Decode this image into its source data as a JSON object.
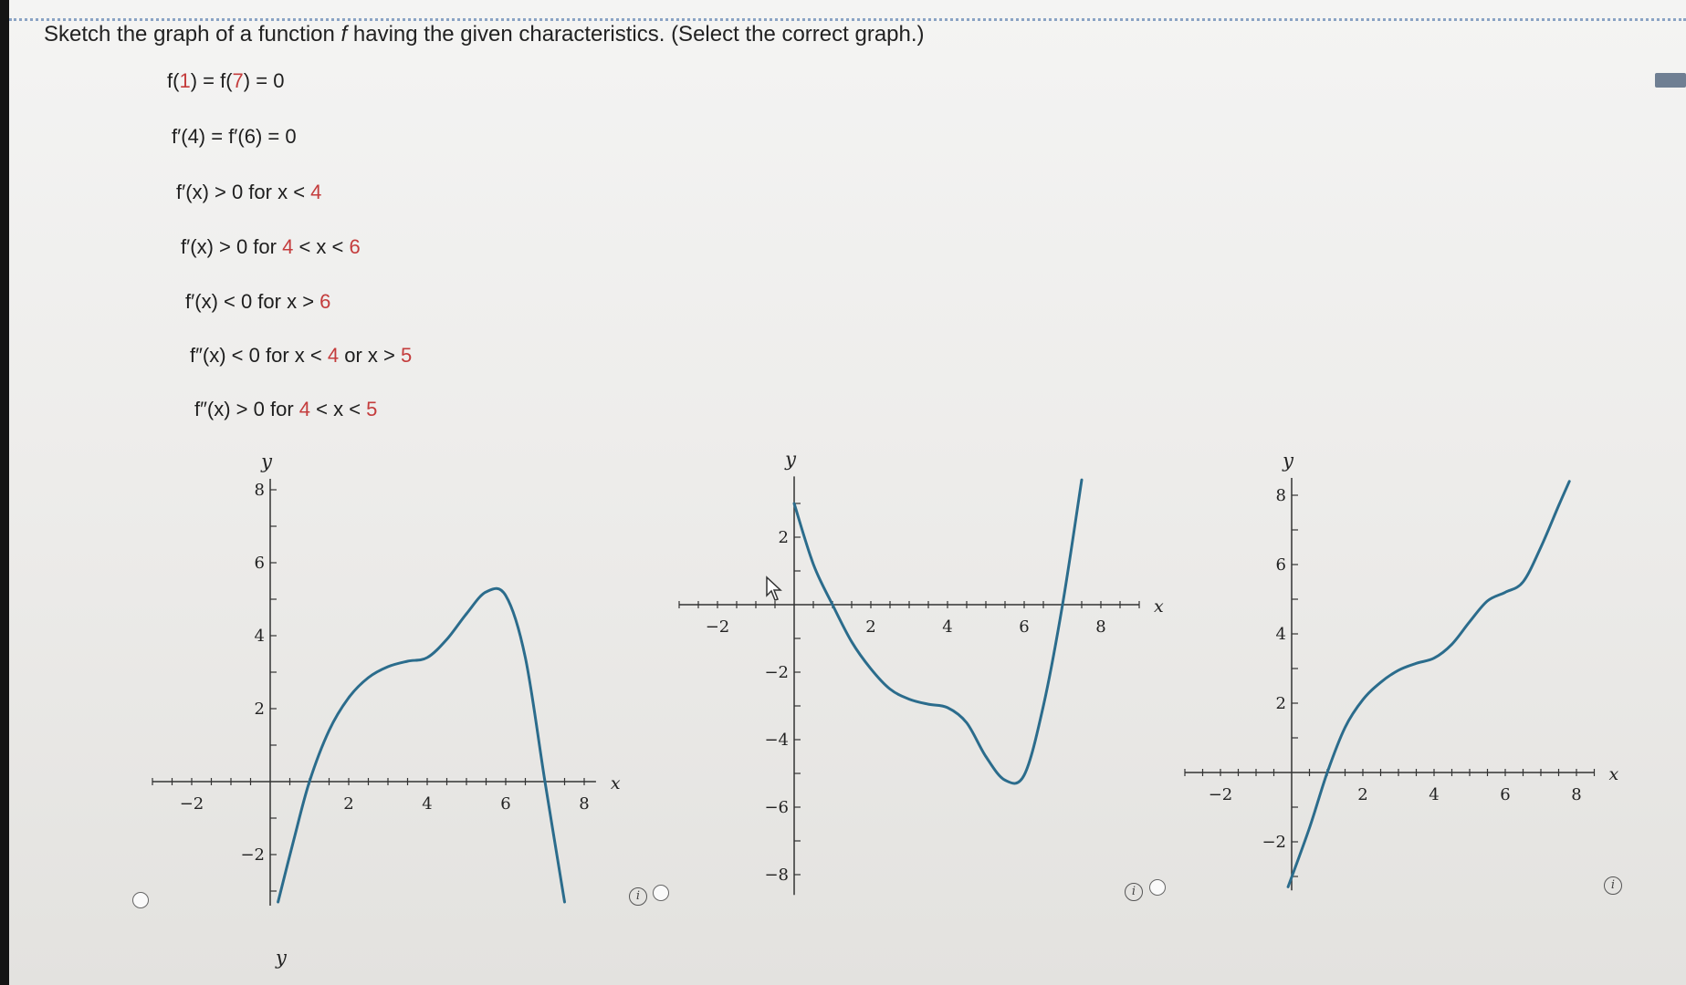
{
  "question": {
    "prefix": "Sketch the graph of a function ",
    "fname": "f",
    "suffix": " having the given characteristics. (Select the correct graph.)"
  },
  "conditions": [
    {
      "parts": [
        {
          "t": "f("
        },
        {
          "t": "1",
          "n": true
        },
        {
          "t": ") = f("
        },
        {
          "t": "7",
          "n": true
        },
        {
          "t": ") = 0"
        }
      ]
    },
    {
      "parts": [
        {
          "t": "f′(4) = f′(6) = 0"
        }
      ]
    },
    {
      "parts": [
        {
          "t": "f′(x) > 0 for x < "
        },
        {
          "t": "4",
          "n": true
        }
      ]
    },
    {
      "parts": [
        {
          "t": "f′(x) > 0 for "
        },
        {
          "t": "4",
          "n": true
        },
        {
          "t": " < x < "
        },
        {
          "t": "6",
          "n": true
        }
      ]
    },
    {
      "parts": [
        {
          "t": "f′(x) < 0 for x > "
        },
        {
          "t": "6",
          "n": true
        }
      ]
    },
    {
      "parts": [
        {
          "t": "f″(x) < 0 for x < "
        },
        {
          "t": "4",
          "n": true
        },
        {
          "t": " or x > "
        },
        {
          "t": "5",
          "n": true
        }
      ]
    },
    {
      "parts": [
        {
          "t": "f″(x) > 0 for "
        },
        {
          "t": "4",
          "n": true
        },
        {
          "t": " < x < "
        },
        {
          "t": "5",
          "n": true
        }
      ]
    }
  ],
  "colors": {
    "accent_number": "#c43c3c",
    "curve": "#2b6c8c"
  },
  "option_info_symbol": "i",
  "partial_axis_label": "y",
  "chart_data": [
    {
      "type": "line",
      "title": "",
      "xlabel": "x",
      "ylabel": "y",
      "xlim": [
        -3,
        8.3
      ],
      "ylim": [
        -3.4,
        8.3
      ],
      "x_ticks": [
        -2,
        2,
        4,
        6,
        8
      ],
      "y_ticks": [
        -2,
        2,
        4,
        6,
        8
      ],
      "x_tick_labels": [
        "−2",
        "2",
        "4",
        "6",
        "8"
      ],
      "y_tick_labels": [
        "−2",
        "2",
        "4",
        "6",
        "8"
      ],
      "grid": false,
      "series": [
        {
          "x": [
            0.2,
            0.6,
            1,
            1.5,
            2,
            2.5,
            3,
            3.5,
            4,
            4.5,
            5,
            5.5,
            6,
            6.5,
            7,
            7.5
          ],
          "y": [
            -3.3,
            -1.6,
            0,
            1.4,
            2.3,
            2.85,
            3.15,
            3.3,
            3.4,
            3.9,
            4.6,
            5.2,
            5.1,
            3.4,
            0,
            -3.3
          ]
        }
      ]
    },
    {
      "type": "line",
      "title": "",
      "xlabel": "x",
      "ylabel": "y",
      "xlim": [
        -3,
        9
      ],
      "ylim": [
        -8.6,
        3.8
      ],
      "x_ticks": [
        -2,
        2,
        4,
        6,
        8
      ],
      "y_ticks": [
        -8,
        -6,
        -4,
        -2,
        2
      ],
      "x_tick_labels": [
        "−2",
        "2",
        "4",
        "6",
        "8"
      ],
      "y_tick_labels": [
        "−8",
        "−6",
        "−4",
        "−2",
        "2"
      ],
      "grid": false,
      "series": [
        {
          "x": [
            0,
            0.5,
            1,
            1.5,
            2,
            2.5,
            3,
            3.5,
            4,
            4.5,
            5,
            5.5,
            6,
            6.5,
            7,
            7.5
          ],
          "y": [
            3,
            1.2,
            0,
            -1.1,
            -1.9,
            -2.5,
            -2.8,
            -2.95,
            -3.05,
            -3.5,
            -4.5,
            -5.2,
            -5.05,
            -3,
            0,
            3.7
          ]
        }
      ]
    },
    {
      "type": "line",
      "title": "",
      "xlabel": "x",
      "ylabel": "y",
      "xlim": [
        -3,
        8.5
      ],
      "ylim": [
        -3.4,
        8.5
      ],
      "x_ticks": [
        -2,
        2,
        4,
        6,
        8
      ],
      "y_ticks": [
        -2,
        2,
        4,
        6,
        8
      ],
      "x_tick_labels": [
        "−2",
        "2",
        "4",
        "6",
        "8"
      ],
      "y_tick_labels": [
        "−2",
        "2",
        "4",
        "6",
        "8"
      ],
      "grid": false,
      "series": [
        {
          "x": [
            -0.1,
            0.5,
            1,
            1.5,
            2,
            2.5,
            3,
            3.5,
            4,
            4.5,
            5,
            5.5,
            6,
            6.5,
            7,
            7.5,
            7.8
          ],
          "y": [
            -3.3,
            -1.6,
            0,
            1.3,
            2.1,
            2.6,
            2.95,
            3.15,
            3.3,
            3.7,
            4.35,
            4.95,
            5.2,
            5.5,
            6.5,
            7.7,
            8.4
          ]
        }
      ]
    }
  ]
}
